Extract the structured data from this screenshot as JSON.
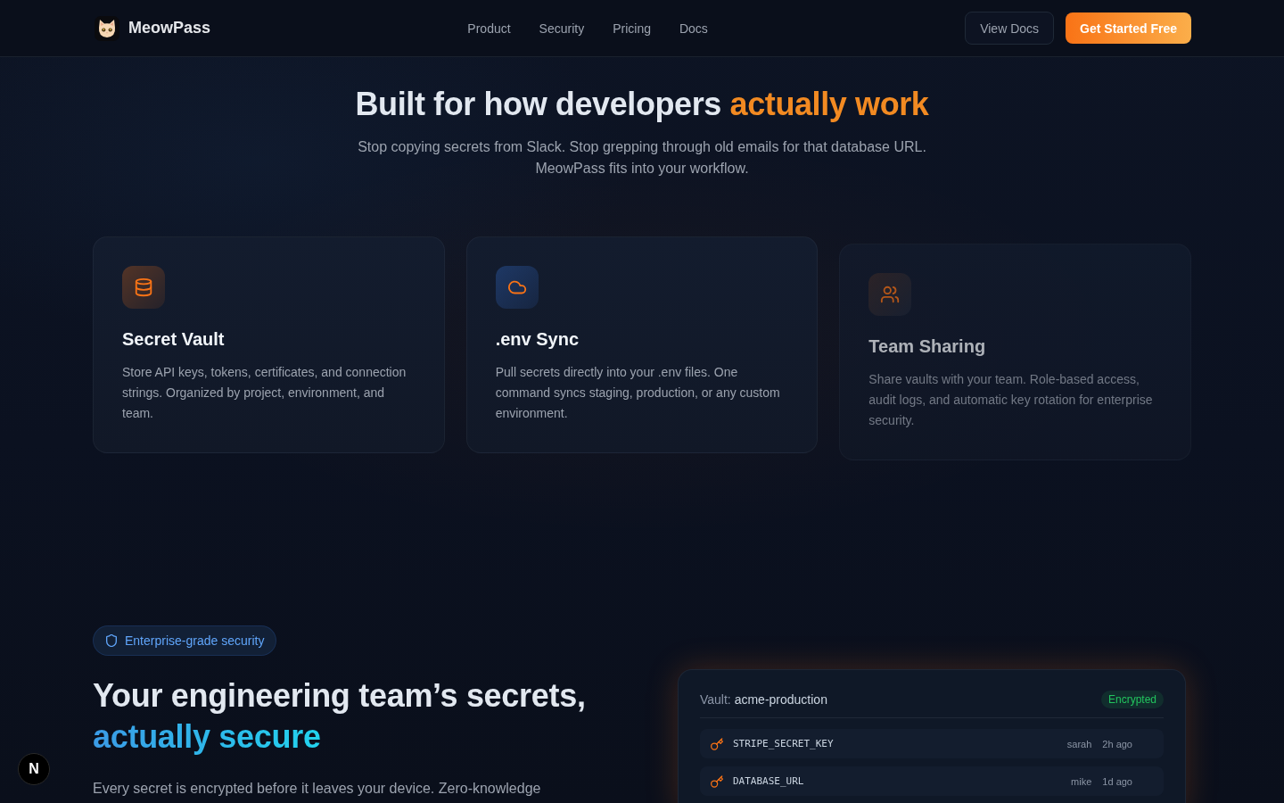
{
  "nav": {
    "brand": "MeowPass",
    "links": [
      {
        "label": "Product"
      },
      {
        "label": "Security"
      },
      {
        "label": "Pricing"
      },
      {
        "label": "Docs"
      }
    ],
    "buttons": [
      {
        "label": "View Docs",
        "kind": "outline"
      },
      {
        "label": "Get Started Free",
        "kind": "primary"
      }
    ]
  },
  "hero": {
    "title": "Built for how developers",
    "title_highlight": "actually work",
    "subtitle": "Stop copying secrets from Slack. Stop grepping through old emails for that database URL. MeowPass fits into your workflow."
  },
  "features": [
    {
      "kind": "database",
      "title": "Secret Vault",
      "description": "Store API keys, tokens, certificates, and connection strings. Organized by project, environment, and team.",
      "dimmed": false
    },
    {
      "kind": "cloud",
      "title": ".env Sync",
      "description": "Pull secrets directly into your .env files. One command syncs staging, production, or any custom environment.",
      "dimmed": false
    },
    {
      "kind": "users",
      "title": "Team Sharing",
      "description": "Share vaults with your team. Role-based access, audit logs, and automatic key rotation for enterprise security.",
      "dimmed": true
    }
  ],
  "security": {
    "badge": "Enterprise-grade security",
    "title": "Your engineering team’s secrets,",
    "title_highlight": "actually secure",
    "description": "Every secret is encrypted before it leaves your device. Zero-knowledge"
  },
  "vault": {
    "label": "Vault:",
    "name": "acme-production",
    "status": "Encrypted",
    "secrets": [
      {
        "name": "STRIPE_SECRET_KEY",
        "owner": "sarah",
        "time": "2h ago"
      },
      {
        "name": "DATABASE_URL",
        "owner": "mike",
        "time": "1d ago"
      }
    ]
  },
  "dev_badge": {
    "label": "N"
  }
}
